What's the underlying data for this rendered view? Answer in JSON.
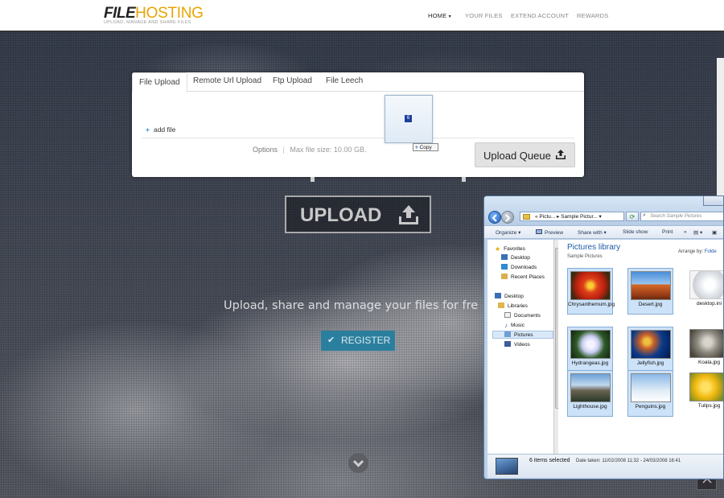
{
  "header": {
    "logo_part1": "FILE",
    "logo_part2": "HOSTING",
    "logo_tagline": "UPLOAD, MANAGE AND SHARE FILES",
    "nav": [
      {
        "label": "HOME"
      },
      {
        "label": "YOUR FILES"
      },
      {
        "label": "EXTEND ACCOUNT"
      },
      {
        "label": "REWARDS"
      }
    ]
  },
  "upload_box": {
    "tabs": [
      {
        "label": "File Upload",
        "active": true
      },
      {
        "label": "Remote Url Upload"
      },
      {
        "label": "Ftp Upload"
      },
      {
        "label": "File Leech"
      }
    ],
    "add_file_label": "add file",
    "options_label": "Options",
    "options_separator": "|",
    "max_size_label": "Max file size: 10.00 GB.",
    "upload_queue_label": "Upload Queue",
    "drag_count": "6",
    "copy_label": "Copy"
  },
  "hero": {
    "upload_button_label": "UPLOAD",
    "tagline": "Upload, share and manage your files for fre",
    "register_label": "REGISTER"
  },
  "explorer": {
    "address_path": "« Pictu... ▸ Sample Pictur... ▾",
    "search_placeholder": "Search Sample Pictures",
    "toolbar": [
      "Organize ▾",
      "Preview",
      "Share with ▾",
      "Slide show",
      "Print"
    ],
    "nav_items": [
      {
        "label": "Favorites",
        "icon": "star-icon"
      },
      {
        "label": "Desktop",
        "icon": "desktop-icon"
      },
      {
        "label": "Downloads",
        "icon": "downloads-icon"
      },
      {
        "label": "Recent Places",
        "icon": "recent-places-icon"
      },
      {
        "label": "Desktop",
        "icon": "desktop-icon"
      },
      {
        "label": "Libraries",
        "icon": "libraries-icon"
      },
      {
        "label": "Documents",
        "icon": "documents-icon"
      },
      {
        "label": "Music",
        "icon": "music-icon"
      },
      {
        "label": "Pictures",
        "icon": "pictures-icon"
      },
      {
        "label": "Videos",
        "icon": "videos-icon"
      }
    ],
    "library_title": "Pictures library",
    "library_subtitle": "Sample Pictures",
    "arrange_by_label": "Arrange by:",
    "arrange_by_value": "Folde",
    "files": [
      {
        "name": "Chrysanthemum.jpg",
        "selected": true
      },
      {
        "name": "Desert.jpg",
        "selected": true
      },
      {
        "name": "desktop.ini",
        "selected": false
      },
      {
        "name": "Hydrangeas.jpg",
        "selected": true
      },
      {
        "name": "Jellyfish.jpg",
        "selected": true
      },
      {
        "name": "Koala.jpg",
        "selected": false
      },
      {
        "name": "Lighthouse.jpg",
        "selected": true
      },
      {
        "name": "Penguins.jpg",
        "selected": true
      },
      {
        "name": "Tulips.jpg",
        "selected": false
      }
    ],
    "status_selected": "6 items selected",
    "status_date": "Date taken: 11/02/2008 11:32 - 24/03/2008 16:41"
  },
  "colors": {
    "accent_yellow": "#e8a400",
    "register_blue": "#2b7f9e",
    "explorer_blue": "#1e5aa8"
  }
}
